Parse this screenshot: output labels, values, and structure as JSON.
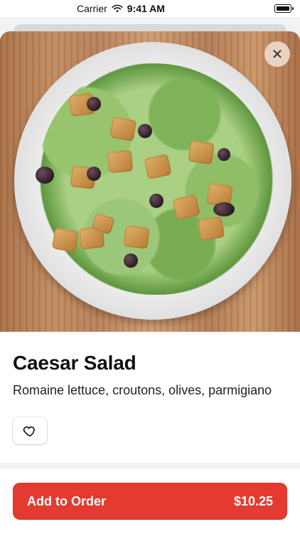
{
  "status": {
    "carrier": "Carrier",
    "time": "9:41 AM"
  },
  "item": {
    "name": "Caesar Salad",
    "description": "Romaine lettuce, croutons, olives, parmigiano"
  },
  "actions": {
    "add_label": "Add to Order",
    "price": "$10.25",
    "close_icon": "close-icon",
    "favorite_icon": "heart-icon",
    "accent_color": "#E53A2F"
  }
}
